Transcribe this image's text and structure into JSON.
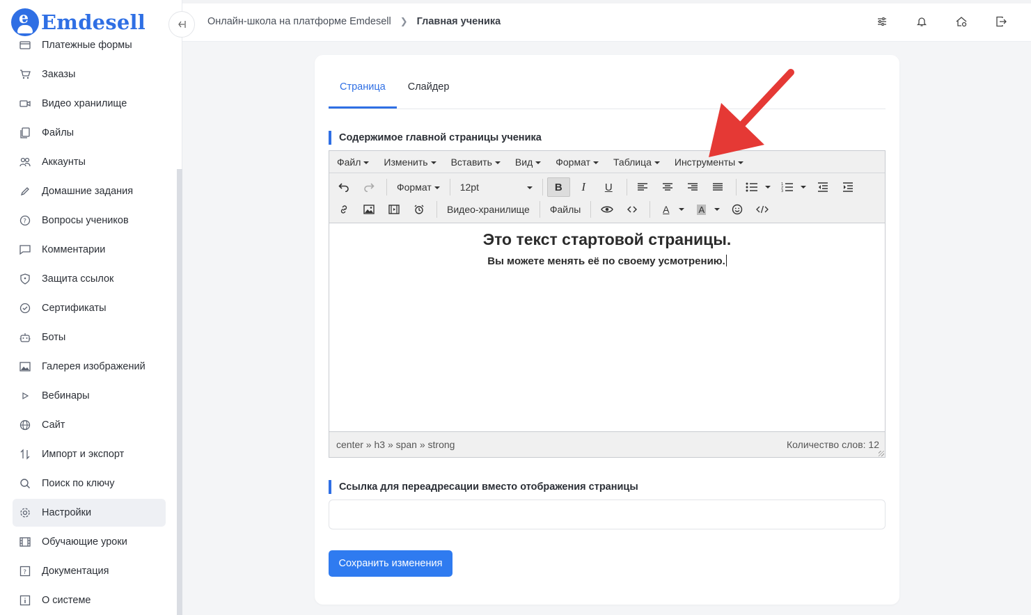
{
  "app": {
    "logo_text": "Emdesell",
    "logo_letter": "e"
  },
  "sidebar": {
    "items": [
      {
        "label": "Платежные формы",
        "icon": "credit-card-icon"
      },
      {
        "label": "Заказы",
        "icon": "cart-icon"
      },
      {
        "label": "Видео хранилище",
        "icon": "video-icon"
      },
      {
        "label": "Файлы",
        "icon": "files-icon"
      },
      {
        "label": "Аккаунты",
        "icon": "users-icon"
      },
      {
        "label": "Домашние задания",
        "icon": "pencil-icon"
      },
      {
        "label": "Вопросы учеников",
        "icon": "question-circle-icon"
      },
      {
        "label": "Комментарии",
        "icon": "comment-icon"
      },
      {
        "label": "Защита ссылок",
        "icon": "shield-icon"
      },
      {
        "label": "Сертификаты",
        "icon": "check-circle-icon"
      },
      {
        "label": "Боты",
        "icon": "robot-icon"
      },
      {
        "label": "Галерея изображений",
        "icon": "image-icon"
      },
      {
        "label": "Вебинары",
        "icon": "play-icon"
      },
      {
        "label": "Сайт",
        "icon": "globe-icon"
      },
      {
        "label": "Импорт и экспорт",
        "icon": "arrows-updown-icon"
      },
      {
        "label": "Поиск по ключу",
        "icon": "search-icon"
      },
      {
        "label": "Настройки",
        "icon": "gear-icon",
        "active": true
      },
      {
        "label": "Обучающие уроки",
        "icon": "film-icon"
      },
      {
        "label": "Документация",
        "icon": "help-square-icon"
      },
      {
        "label": "О системе",
        "icon": "info-square-icon"
      }
    ]
  },
  "topbar": {
    "breadcrumb_root": "Онлайн-школа на платформе Emdesell",
    "breadcrumb_current": "Главная ученика"
  },
  "tabs": [
    "Страница",
    "Слайдер"
  ],
  "content_section": {
    "label": "Содержимое главной страницы ученика"
  },
  "editor": {
    "menu": [
      "Файл",
      "Изменить",
      "Вставить",
      "Вид",
      "Формат",
      "Таблица",
      "Инструменты"
    ],
    "format_select": "Формат",
    "size_select": "12pt",
    "video_storage_btn": "Видео-хранилище",
    "files_btn": "Файлы",
    "heading": "Это текст стартовой страницы.",
    "paragraph": "Вы можете менять её по своему усмотрению.",
    "path": "center » h3 » span » strong",
    "word_count": "Количество слов: 12"
  },
  "redirect_section": {
    "label": "Ссылка для переадресации вместо отображения страницы",
    "value": "",
    "placeholder": ""
  },
  "save_button": "Сохранить изменения",
  "colors": {
    "accent": "#2f6fe4",
    "annotation_arrow": "#e53935"
  }
}
